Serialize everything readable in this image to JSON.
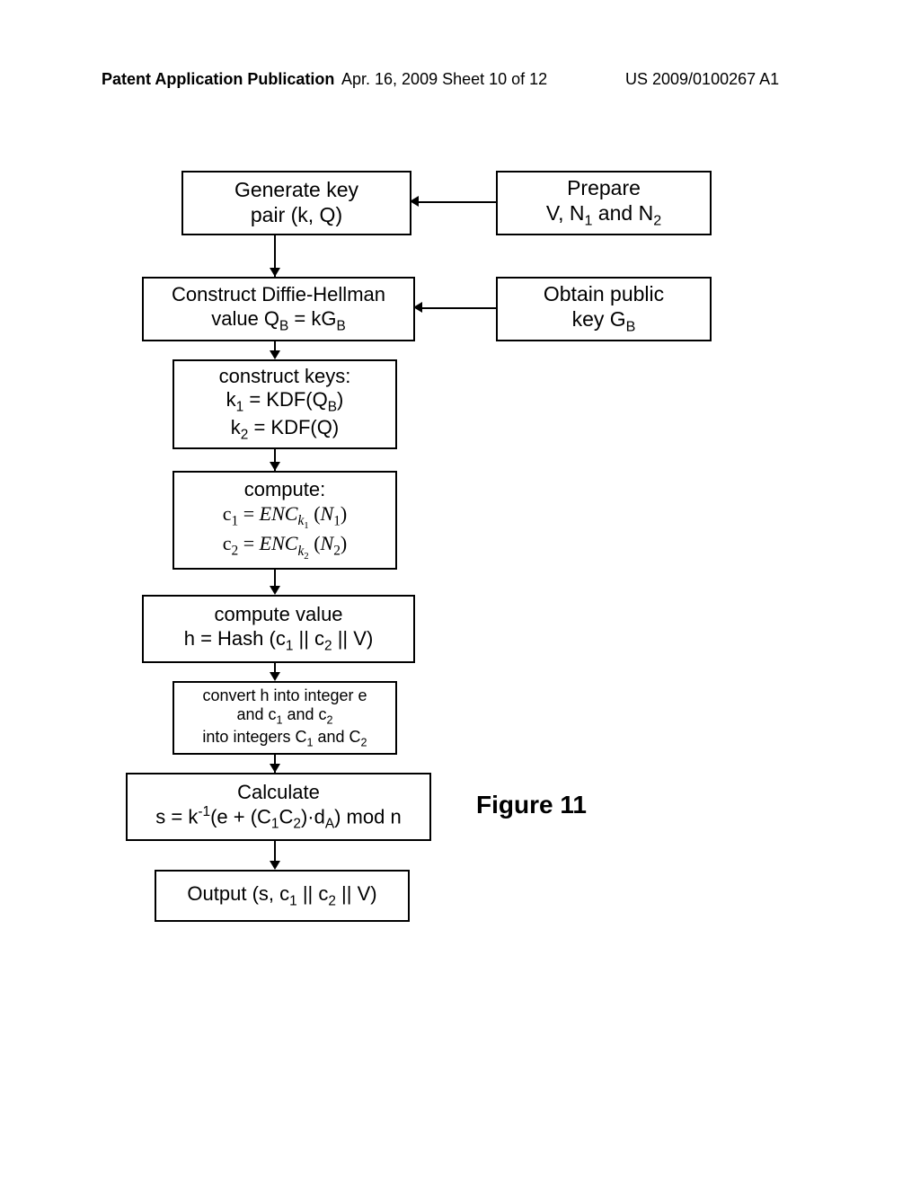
{
  "header": {
    "left": "Patent Application Publication",
    "center": "Apr. 16, 2009  Sheet 10 of 12",
    "right": "US 2009/0100267 A1"
  },
  "boxes": {
    "b1_line1": "Generate key",
    "b1_line2": "pair (k, Q)",
    "b2_line1": "Prepare",
    "b2_line2_html": "V, N<sub>1</sub> and N<sub>2</sub>",
    "b3_line1": "Construct Diffie-Hellman",
    "b3_line2_html": "value Q<sub>B</sub> = kG<sub>B</sub>",
    "b4_line1": "Obtain public",
    "b4_line2_html": "key G<sub>B</sub>",
    "b5_line1": "construct keys:",
    "b5_line2_html": "k<sub>1</sub> = KDF(Q<sub>B</sub>)",
    "b5_line3_html": "k<sub>2</sub> = KDF(Q)",
    "b6_line1": "compute:",
    "b6_line2_html": "c<sub>1</sub> = <i>ENC</i><sub><i>k</i><sub>1</sub></sub> (<i>N</i><sub>1</sub>)",
    "b6_line3_html": "c<sub>2</sub> = <i>ENC</i><sub><i>k</i><sub>2</sub></sub> (<i>N</i><sub>2</sub>)",
    "b7_line1": "compute value",
    "b7_line2_html": "h = Hash (c<sub>1</sub> || c<sub>2</sub> || V)",
    "b8_line1": "convert h into integer e",
    "b8_line2_html": "and c<sub>1</sub> and c<sub>2</sub>",
    "b8_line3_html": "into integers C<sub>1</sub> and C<sub>2</sub>",
    "b9_line1": "Calculate",
    "b9_line2_html": "s = k<sup>-1</sup>(e + (C<sub>1</sub>C<sub>2</sub>)·d<sub>A</sub>) mod n",
    "b10_html": "Output (s, c<sub>1</sub> || c<sub>2</sub> || V)"
  },
  "figure_label": "Figure 11"
}
